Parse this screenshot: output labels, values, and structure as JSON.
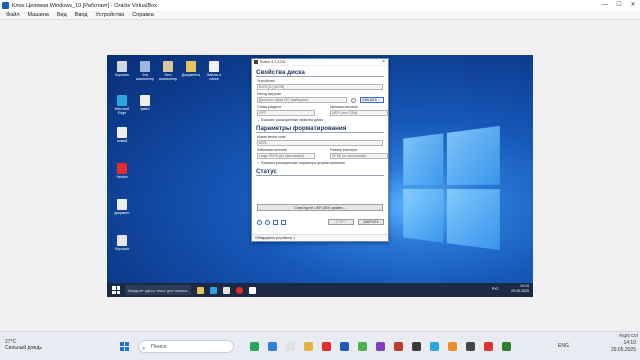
{
  "host": {
    "window_title": "Клон Целевая Windows_10 [Работает] - Oracle VirtualBox",
    "window_buttons": [
      "—",
      "☐",
      "✕"
    ],
    "menu": [
      "Файл",
      "Машина",
      "Вид",
      "Ввод",
      "Устройства",
      "Справка"
    ],
    "side_label": "Right Ctrl"
  },
  "guest": {
    "desktop_icons": [
      {
        "label": "Корзина",
        "color": "#cfd8e6"
      },
      {
        "label": "Эта компьютер",
        "color": "#9fb7d8"
      },
      {
        "label": "Этот компьютер",
        "color": "#d8c79a"
      },
      {
        "label": "Документы",
        "color": "#e8c45c"
      },
      {
        "label": "Файлы и папки",
        "color": "#f2f2f2"
      },
      {
        "label": "Microsoft Edge",
        "color": "#2aa6e0"
      },
      {
        "label": "файл",
        "color": "#eeeeee"
      },
      {
        "label": "новый",
        "color": "#eeeeee"
      },
      {
        "label": "Yandex",
        "color": "#e52b2b"
      },
      {
        "label": "документ",
        "color": "#eeeeee"
      },
      {
        "label": "Корзина",
        "color": "#e6e6e6"
      }
    ],
    "taskbar": {
      "search_placeholder": "Введите здесь текст для поиска",
      "lang": "РУС",
      "time": "14:10",
      "date": "29.05.2025"
    }
  },
  "rufus": {
    "title": "Rufus 4.7.2231",
    "drive_section": "Свойства диска",
    "device_label": "Устройство",
    "device_value": "8478 (G:) [64TB]",
    "boot_label": "Метод загрузки",
    "boot_value": "Диск или образ ISO (выберите)",
    "select_button": "СКАЧАТЬ",
    "partition_label": "Схема раздела",
    "partition_value": "GPT",
    "target_label": "Целевая система",
    "target_value": "UEFI (non CSM)",
    "advanced_drive": "Показать расширенные свойства диска",
    "format_section": "Параметры форматирования",
    "volume_label_caption": "Новая метка тома",
    "volume_label_value": "8478",
    "fs_label": "Файловая система",
    "fs_value": "Large FAT32 (по умолчанию)",
    "cluster_label": "Размер кластера",
    "cluster_value": "32 КБ (по умолчанию)",
    "advanced_format": "Показать расширенные параметры форматирования",
    "status_section": "Статус",
    "status_text": "Checking for UEFI DBX updates...",
    "start_button": "СТАРТ",
    "close_button": "ЗАКРЫТЬ",
    "footer": "Обнаружено устройств: 1"
  },
  "taskbar": {
    "weather_temp": "27°C",
    "weather_desc": "Сильный дождь",
    "search_placeholder": "Поиск",
    "lang": "ENG",
    "time": "14:10",
    "date": "29.05.2025"
  }
}
